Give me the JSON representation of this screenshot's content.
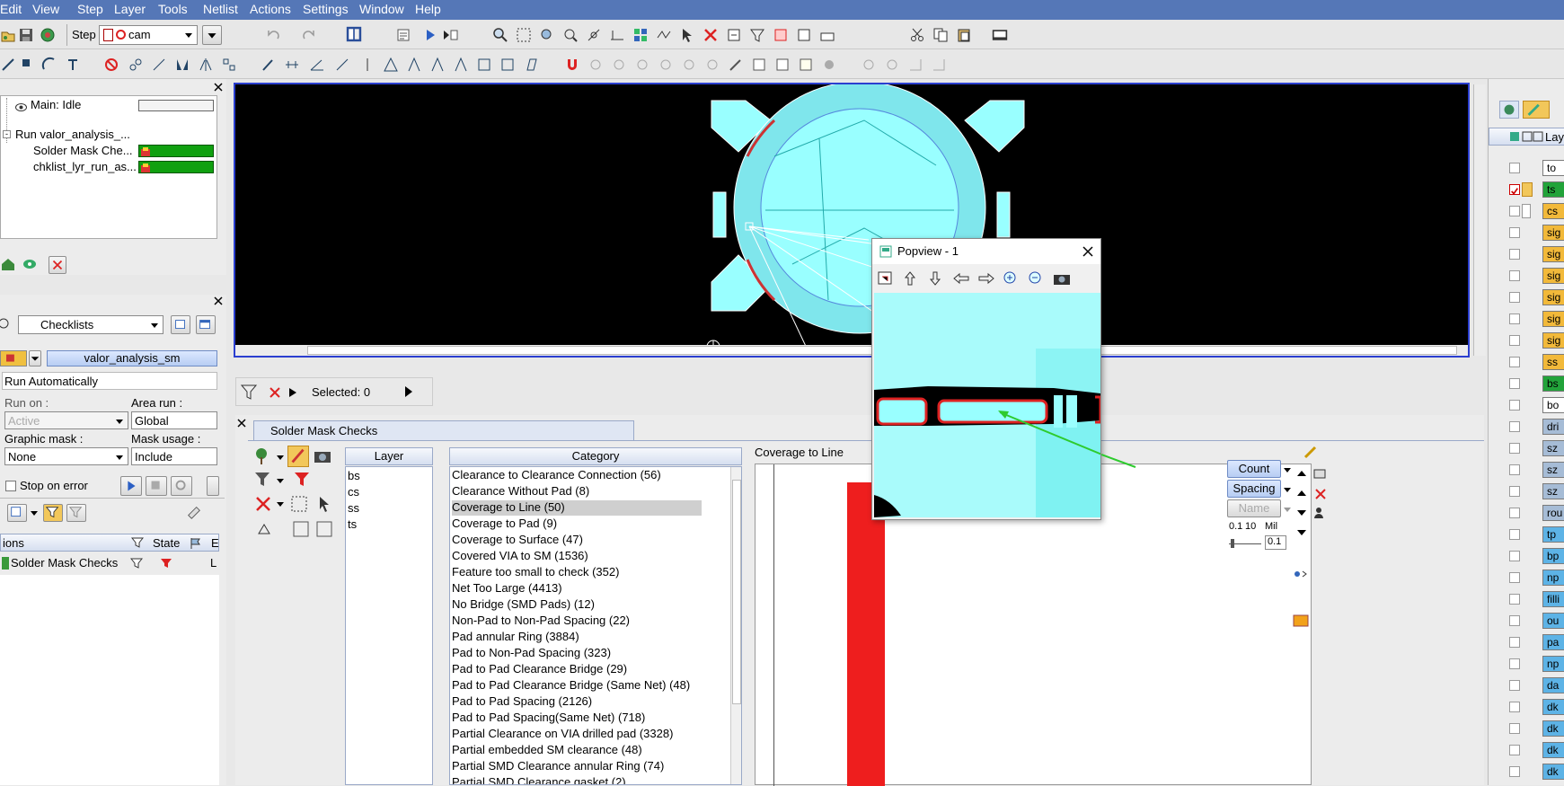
{
  "menu": [
    "Edit",
    "View",
    "Step",
    "Layer",
    "Tools",
    "Netlist",
    "Actions",
    "Settings",
    "Window",
    "Help"
  ],
  "toolbar": {
    "step_label": "Step",
    "step_value": "cam"
  },
  "job_tree": {
    "main_status": "Main: Idle",
    "run_label": "Run valor_analysis_...",
    "children": [
      "Solder Mask Che...",
      "chklist_lyr_run_as..."
    ]
  },
  "checklists": {
    "combo": "Checklists",
    "name": "valor_analysis_sm",
    "run_mode": "Run Automatically",
    "run_on_label": "Run on :",
    "run_on_value": "Active",
    "area_run_label": "Area run :",
    "area_run_value": "Global",
    "graphic_mask_label": "Graphic mask :",
    "graphic_mask_value": "None",
    "mask_usage_label": "Mask usage :",
    "mask_usage_value": "Include",
    "stop_on_error": "Stop on error",
    "col_actions": "ions",
    "col_state": "State",
    "col_e": "E",
    "row_name": "Solder Mask Checks",
    "row_e": "L"
  },
  "graphic": {
    "selected": "Selected: 0"
  },
  "results": {
    "tab": "Solder Mask Checks",
    "layer_header": "Layer",
    "category_header": "Category",
    "layers": [
      "bs",
      "cs",
      "ss",
      "ts"
    ],
    "categories": [
      "Clearance to Clearance Connection  (56)",
      "Clearance Without Pad  (8)",
      "Coverage to Line  (50)",
      "Coverage to Pad  (9)",
      "Coverage to Surface  (47)",
      "Covered VIA to SM  (1536)",
      "Feature too small to check  (352)",
      "Net Too Large  (4413)",
      "No Bridge (SMD Pads)  (12)",
      "Non-Pad to Non-Pad Spacing  (22)",
      "Pad annular Ring  (3884)",
      "Pad to Non-Pad Spacing  (323)",
      "Pad to Pad Clearance Bridge  (29)",
      "Pad to Pad Clearance Bridge (Same Net)  (48)",
      "Pad to Pad Spacing  (2126)",
      "Pad to Pad Spacing(Same Net)  (718)",
      "Partial Clearance on VIA drilled pad  (3328)",
      "Partial embedded SM clearance  (48)",
      "Partial SMD Clearance annular Ring  (74)",
      "Partial SMD Clearance gasket  (2)"
    ],
    "selected_index": 2,
    "detail_title": "Coverage to Line",
    "count_btn": "Count",
    "spacing_btn": "Spacing",
    "name_btn": "Name",
    "slider_min": "0.1",
    "slider_max": "10",
    "slider_unit": "Mil",
    "slider_value": "0.1"
  },
  "popview": {
    "title": "Popview - 1"
  },
  "layers_panel": {
    "header": "Lay",
    "items": [
      {
        "name": "to",
        "color": "#ffffff"
      },
      {
        "name": "ts",
        "color": "#22a33a"
      },
      {
        "name": "cs",
        "color": "#f2b93a"
      },
      {
        "name": "sig",
        "color": "#f2b93a"
      },
      {
        "name": "sig",
        "color": "#f2b93a"
      },
      {
        "name": "sig",
        "color": "#f2b93a"
      },
      {
        "name": "sig",
        "color": "#f2b93a"
      },
      {
        "name": "sig",
        "color": "#f2b93a"
      },
      {
        "name": "sig",
        "color": "#f2b93a"
      },
      {
        "name": "ss",
        "color": "#f2b93a"
      },
      {
        "name": "bs",
        "color": "#22a33a"
      },
      {
        "name": "bo",
        "color": "#ffffff"
      },
      {
        "name": "dri",
        "color": "#a6bcd6"
      },
      {
        "name": "sz",
        "color": "#a6bcd6"
      },
      {
        "name": "sz",
        "color": "#a6bcd6"
      },
      {
        "name": "sz",
        "color": "#a6bcd6"
      },
      {
        "name": "rou",
        "color": "#a6bcd6"
      },
      {
        "name": "tp",
        "color": "#5db3e6"
      },
      {
        "name": "bp",
        "color": "#5db3e6"
      },
      {
        "name": "np",
        "color": "#5db3e6"
      },
      {
        "name": "filli",
        "color": "#5db3e6"
      },
      {
        "name": "ou",
        "color": "#5db3e6"
      },
      {
        "name": "pa",
        "color": "#5db3e6"
      },
      {
        "name": "np",
        "color": "#5db3e6"
      },
      {
        "name": "da",
        "color": "#5db3e6"
      },
      {
        "name": "dk",
        "color": "#5db3e6"
      },
      {
        "name": "dk",
        "color": "#5db3e6"
      },
      {
        "name": "dk",
        "color": "#5db3e6"
      },
      {
        "name": "dk",
        "color": "#5db3e6"
      }
    ]
  }
}
